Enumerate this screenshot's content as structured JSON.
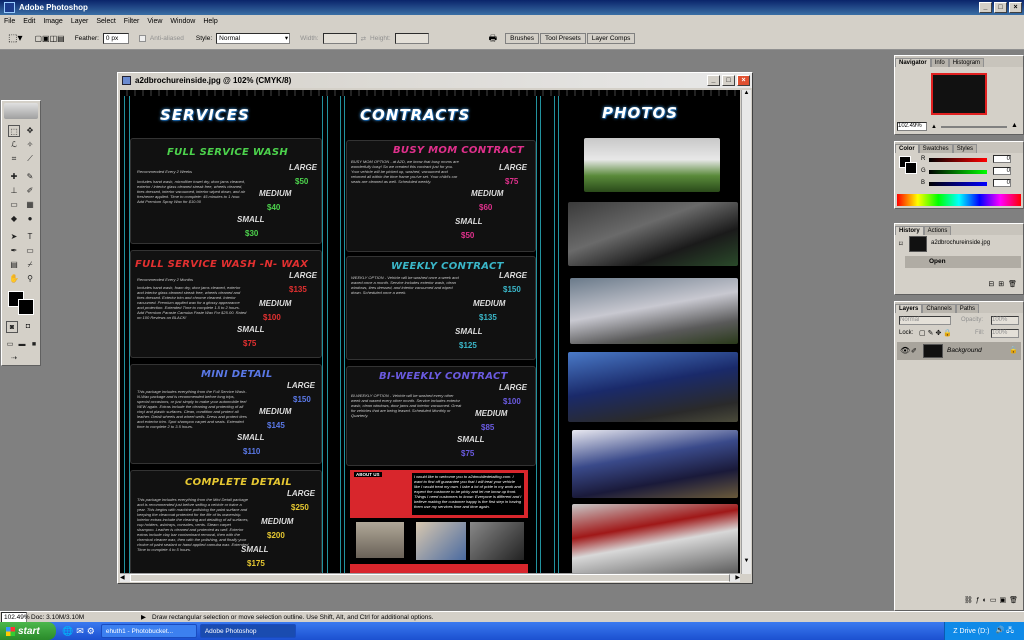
{
  "app": {
    "title": "Adobe Photoshop"
  },
  "menu": [
    "File",
    "Edit",
    "Image",
    "Layer",
    "Select",
    "Filter",
    "View",
    "Window",
    "Help"
  ],
  "options": {
    "feather_label": "Feather:",
    "feather_value": "0 px",
    "antialiased": "Anti-aliased",
    "style_label": "Style:",
    "style_value": "Normal",
    "width_label": "Width:",
    "height_label": "Height:",
    "palette_tabs": [
      "Brushes",
      "Tool Presets",
      "Layer Comps"
    ]
  },
  "document": {
    "title": "a2dbrochureinside.jpg @ 102% (CMYK/8)",
    "headers": {
      "services": "SERVICES",
      "contracts": "CONTRACTS",
      "photos": "PHOTOS"
    },
    "services": [
      {
        "title": "FULL SERVICE WASH",
        "note": "Recommended Every 2 Weeks",
        "desc": "Includes hand wash, microfiber towel dry, door jams cleaned, exterior / interior glass cleaned streak free, wheels cleaned, tires dressed, interior vacuumed, interior wiped down, and air freshener applied. Time to complete: 45 minutes to 1 hour. Add Premium Spray Wax for $10.00",
        "prices": [
          {
            "size": "LARGE",
            "price": "$50"
          },
          {
            "size": "MEDIUM",
            "price": "$40"
          },
          {
            "size": "SMALL",
            "price": "$30"
          }
        ],
        "color": "#4cd24c"
      },
      {
        "title": "FULL SERVICE WASH -N- WAX",
        "note": "Recommended Every 2 Months",
        "desc": "Includes hand wash, foam dry, door jams cleaned, exterior and interior glass cleaned streak free, wheels cleaned and tires dressed. Exterior trim and chrome cleaned. Interior vacuumed. Premium applied wax for a glossy appearance and protection. Extended Time to complete 1.5 to 2 hours. Add Premium Paraste Carnuba Paste Wax For $25.00. Rated on 100 Reviews on BLACK!",
        "prices": [
          {
            "size": "LARGE",
            "price": "$135"
          },
          {
            "size": "MEDIUM",
            "price": "$100"
          },
          {
            "size": "SMALL",
            "price": "$75"
          }
        ],
        "color": "#e23030"
      },
      {
        "title": "MINI DETAIL",
        "note": "",
        "desc": "This package includes everything from the Full Service Wash-N-Wax package and is recommended before long trips, special occasions, or just simply to make your automobile feel NEW again. Extras include the cleaning and protecting of all vinyl and plastic surfaces. Clean, condition and protect all leather. Detail wheels and wheel wells. Dress and protect tires and exterior trim. Spot shampoo carpet and seats. Extended time to complete 2 to 3.5 hours.",
        "prices": [
          {
            "size": "LARGE",
            "price": "$150"
          },
          {
            "size": "MEDIUM",
            "price": "$145"
          },
          {
            "size": "SMALL",
            "price": "$110"
          }
        ],
        "color": "#5a78e6"
      },
      {
        "title": "COMPLETE DETAIL",
        "note": "",
        "desc": "This package includes everything from the Mini Detail package and is recommended just before selling a vehicle or twice a year. This begins with machine polishing the paint surface and keeping the clearcoat protected for the life of its ownership. Interior extras include the cleaning and detailing of all surfaces, cup holders, ashtrays, consoles, vents. Steam carpet shampoo. Leather is cleaned and protected as well. Exterior extras include clay bar contaminant removal, then with the chemical cleaner wax, then with the polishing, and finally your choice of paint sealant or hand applied carnuba wax. Extended Time to complete 4 to 5 hours.",
        "prices": [
          {
            "size": "LARGE",
            "price": "$250"
          },
          {
            "size": "MEDIUM",
            "price": "$200"
          },
          {
            "size": "SMALL",
            "price": "$175"
          }
        ],
        "color": "#e6c832"
      }
    ],
    "contracts": [
      {
        "title": "BUSY MOM CONTRACT",
        "desc": "BUSY MOM OPTION - at A2D, we know that busy moms are wonderfully busy! So we created this contract just for you. Your vehicle will be picked up, washed, vacuumed and returned all within the time frame you've set. Your child's car seats are cleaned as well. Scheduled weekly.",
        "prices": [
          {
            "size": "LARGE",
            "price": "$75"
          },
          {
            "size": "MEDIUM",
            "price": "$60"
          },
          {
            "size": "SMALL",
            "price": "$50"
          }
        ],
        "color": "#e0308c"
      },
      {
        "title": "WEEKLY CONTRACT",
        "desc": "WEEKLY OPTION - Vehicle will be washed once a week and waxed once a month. Service includes exterior wash, clean windows, tires dressed, and interior vacuumed and wiped down. Scheduled once a week.",
        "prices": [
          {
            "size": "LARGE",
            "price": "$150"
          },
          {
            "size": "MEDIUM",
            "price": "$135"
          },
          {
            "size": "SMALL",
            "price": "$125"
          }
        ],
        "color": "#3ab6c8"
      },
      {
        "title": "BI-WEEKLY CONTRACT",
        "desc": "BI-WEEKLY OPTION - Vehicle will be washed every other week and waxed every other month. Service includes exterior wash, clean windows, door jams and interior vacuumed. Great for vehicles that are being leased. Scheduled Monthly or Quarterly.",
        "prices": [
          {
            "size": "LARGE",
            "price": "$100"
          },
          {
            "size": "MEDIUM",
            "price": "$85"
          },
          {
            "size": "SMALL",
            "price": "$75"
          }
        ],
        "color": "#6a5ae0"
      }
    ],
    "about": {
      "heading": "ABOUT US",
      "text": "I would like to welcome you to a2dmobiledetailing.com. I want to first off guarantee you that I will treat your vehicle like I would treat my own. I take a lot of pride in my work and expect the customer to be picky and let me know up front. Things I need customers to know: Everyone is different and I believe making the customer happy is the first step in having them use my services time and time again."
    }
  },
  "panels": {
    "navigator": {
      "tabs": [
        "Navigator",
        "Info",
        "Histogram"
      ],
      "zoom": "102.49%"
    },
    "color": {
      "tabs": [
        "Color",
        "Swatches",
        "Styles"
      ],
      "channels": [
        {
          "label": "R",
          "value": "0"
        },
        {
          "label": "G",
          "value": "0"
        },
        {
          "label": "B",
          "value": "0"
        }
      ]
    },
    "history": {
      "tabs": [
        "History",
        "Actions"
      ],
      "snapshot": "a2dbrochureinside.jpg",
      "items": [
        "Open"
      ]
    },
    "layers": {
      "tabs": [
        "Layers",
        "Channels",
        "Paths"
      ],
      "blend": "Normal",
      "opacity_label": "Opacity:",
      "opacity_value": "100%",
      "lock_label": "Lock:",
      "fill_label": "Fill:",
      "fill_value": "100%",
      "layer_name": "Background"
    }
  },
  "status": {
    "zoom": "102.49%",
    "doc": "Doc: 3.10M/3.10M",
    "hint": "Draw rectangular selection or move selection outline.  Use Shift, Alt, and Ctrl for additional options."
  },
  "taskbar": {
    "start": "start",
    "tasks": [
      "ehuth1 - Photobucket...",
      "Adobe Photoshop"
    ],
    "tray": "Z Drive (D:)"
  },
  "colors": {
    "titlebar": "#0a246a",
    "panel": "#d4d0c8",
    "guide": "#2ab6c6",
    "taskbar": "#245edb"
  }
}
